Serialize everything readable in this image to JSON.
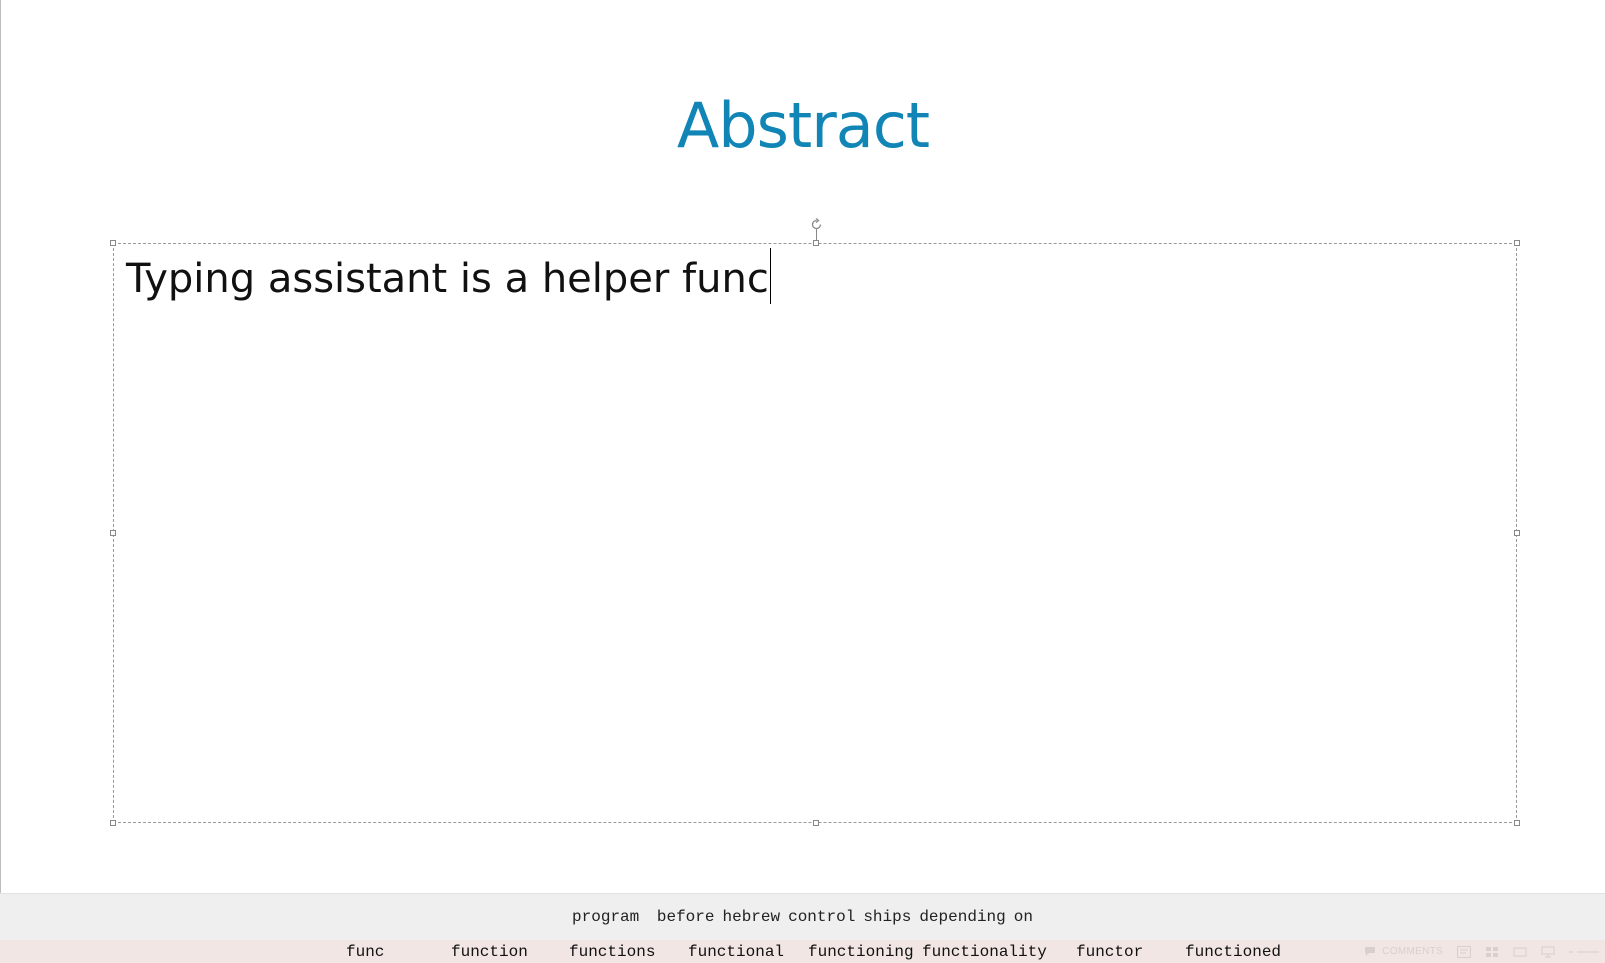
{
  "slide": {
    "title": "Abstract",
    "body_text": "Typing assistant is a helper func"
  },
  "next_word_predictions": [
    "program",
    "before",
    "hebrew",
    "control",
    "ships",
    "depending",
    "on"
  ],
  "completions": [
    "func",
    "function",
    "functions",
    "functional",
    "functioning",
    "functionality",
    "functor",
    "functioned"
  ],
  "status_bar": {
    "comments_label": "COMMENTS",
    "icons": [
      "notes-icon",
      "slide-sorter-icon",
      "reading-view-icon",
      "slideshow-icon",
      "zoom-slider-icon"
    ]
  },
  "colors": {
    "title": "#1185b6",
    "prediction_bar_bg": "#efefef",
    "completion_bar_bg": "#f1e6e3"
  }
}
